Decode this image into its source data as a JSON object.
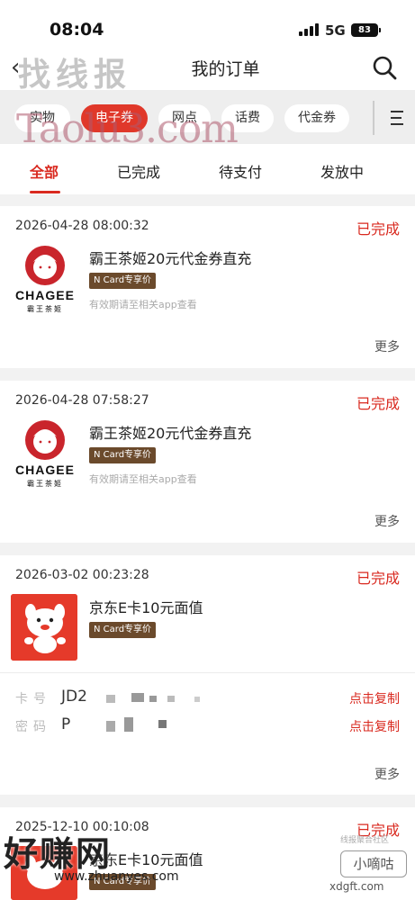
{
  "status_bar": {
    "time": "08:04",
    "network": "5G",
    "battery": "83"
  },
  "nav": {
    "title": "我的订单"
  },
  "watermarks": {
    "top_cn": "找线报",
    "top_en": "Taolu3.com",
    "bottom_left": "好赚网",
    "bottom_left_url": "www.zhuanyes.com",
    "bottom_right": "小嘀咕",
    "bottom_right_top": "线报聚合社区",
    "bottom_right_url": "xdgft.com"
  },
  "categories": [
    "实物",
    "电子券",
    "网点",
    "话费",
    "代金券"
  ],
  "active_category": "电子券",
  "tabs": [
    "全部",
    "已完成",
    "待支付",
    "发放中"
  ],
  "active_tab": "全部",
  "orders": [
    {
      "datetime": "2026-04-28 08:00:32",
      "status": "已完成",
      "title": "霸王茶姬20元代金券直充",
      "badge": "N Card专享价",
      "note": "有效期请至相关app查看",
      "brand": "CHAGEE",
      "brand_cn": "霸王茶姬",
      "more": "更多"
    },
    {
      "datetime": "2026-04-28 07:58:27",
      "status": "已完成",
      "title": "霸王茶姬20元代金券直充",
      "badge": "N Card专享价",
      "note": "有效期请至相关app查看",
      "brand": "CHAGEE",
      "brand_cn": "霸王茶姬",
      "more": "更多"
    },
    {
      "datetime": "2026-03-02 00:23:28",
      "status": "已完成",
      "title": "京东E卡10元面值",
      "badge": "N Card专享价",
      "card_label": "卡号",
      "card_value": "JD2",
      "card_copy": "点击复制",
      "pwd_label": "密码",
      "pwd_value": "P",
      "pwd_copy": "点击复制",
      "more": "更多"
    },
    {
      "datetime": "2025-12-10 00:10:08",
      "status": "已完成",
      "title": "京东E卡10元面值",
      "badge": "N Card专享价"
    }
  ],
  "colors": {
    "accent": "#d9291f",
    "badge": "#6b4a2c",
    "jd_red": "#e53a2a"
  },
  "icons": [
    "back-icon",
    "search-icon",
    "menu-icon",
    "signal-icon",
    "battery-icon"
  ]
}
